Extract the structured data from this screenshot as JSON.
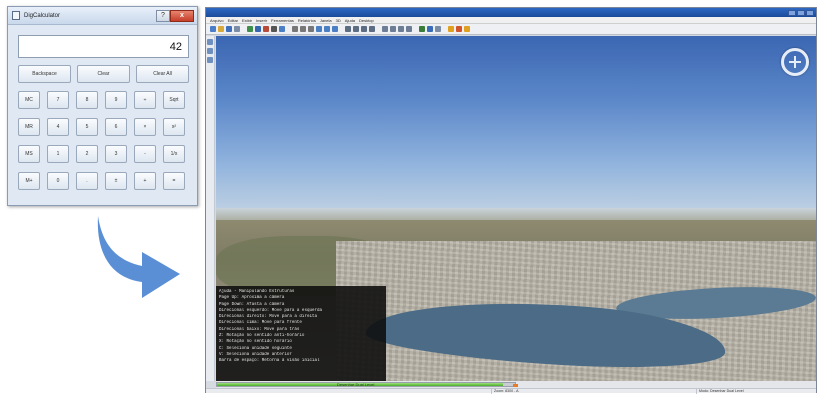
{
  "calculator": {
    "title": "DigCalculator",
    "display": "42",
    "top_buttons": [
      "Backspace",
      "Clear",
      "Clear All"
    ],
    "rows": [
      [
        "MC",
        "7",
        "8",
        "9",
        "÷",
        "Sqrt"
      ],
      [
        "MR",
        "4",
        "5",
        "6",
        "×",
        "x²"
      ],
      [
        "MS",
        "1",
        "2",
        "3",
        "-",
        "1/x"
      ],
      [
        "M+",
        "0",
        ".",
        "±",
        "+",
        "="
      ]
    ],
    "window_controls": {
      "help": "?",
      "close": "x"
    }
  },
  "arrow": {
    "color": "#5a8fd6"
  },
  "viewer": {
    "menu": [
      "Arquivo",
      "Editar",
      "Exibir",
      "Inserir",
      "Ferramentas",
      "Relatórios",
      "Janela",
      "3D",
      "Ajuda",
      "Desktop"
    ],
    "help_panel": [
      "Ajuda - Manipulando Estruturas",
      "Page Up: Aproxima a câmera",
      "Page Down: Afasta a câmera",
      "Direcional esquerdo: Move para a esquerda",
      "Direcional direito: Move para a direita",
      "Direcional cima: Move para frente",
      "Direcional baixo: Move para trás",
      "Z: Rotação no sentido anti-horário",
      "X: Rotação no sentido horário",
      "C: Seleciona unidade seguinte",
      "V: Seleciona unidade anterior",
      "Barra de espaço: Retorna à visão inicial"
    ],
    "progress": {
      "label": "Desenhar Dual Level",
      "value": 0.96
    },
    "status": {
      "cell1": "Zoom: 8300 - A",
      "cell2": "Modo: Desenhar Dual Level"
    },
    "colors": {
      "titlebar": "#2257b0",
      "sky_top": "#3b66b2",
      "water": "#4b6b86"
    }
  }
}
